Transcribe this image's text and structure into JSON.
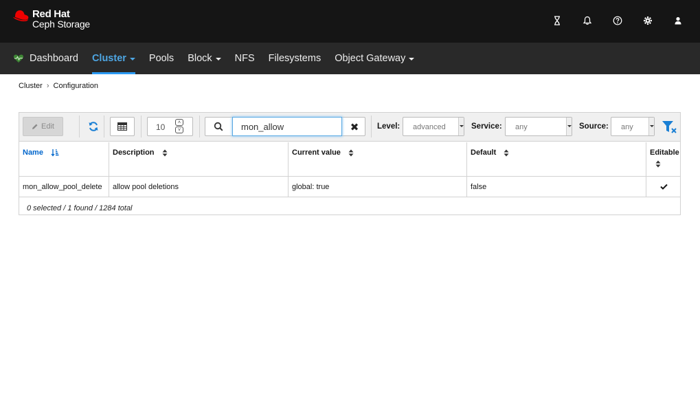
{
  "brand": {
    "line1": "Red Hat",
    "line2": "Ceph Storage",
    "accent": "#ee0000"
  },
  "header_icons": [
    "hourglass-icon",
    "bell-icon",
    "help-icon",
    "gear-icon",
    "user-icon"
  ],
  "nav": {
    "items": [
      {
        "label": "Dashboard",
        "active": false,
        "dropdown": false
      },
      {
        "label": "Cluster",
        "active": true,
        "dropdown": true
      },
      {
        "label": "Pools",
        "active": false,
        "dropdown": false
      },
      {
        "label": "Block",
        "active": false,
        "dropdown": true
      },
      {
        "label": "NFS",
        "active": false,
        "dropdown": false
      },
      {
        "label": "Filesystems",
        "active": false,
        "dropdown": false
      },
      {
        "label": "Object Gateway",
        "active": false,
        "dropdown": true
      }
    ],
    "active_color": "#2b9af3"
  },
  "breadcrumb": {
    "parent": "Cluster",
    "current": "Configuration"
  },
  "toolbar": {
    "edit_label": "Edit",
    "page_size": "10",
    "search_value": "mon_allow",
    "level_label": "Level:",
    "level_value": "advanced",
    "service_label": "Service:",
    "service_value": "any",
    "source_label": "Source:",
    "source_value": "any"
  },
  "table": {
    "columns": [
      "Name",
      "Description",
      "Current value",
      "Default",
      "Editable"
    ],
    "rows": [
      {
        "name": "mon_allow_pool_delete",
        "description": "allow pool deletions",
        "current": "global: true",
        "default": "false",
        "editable": true
      }
    ],
    "footer": "0 selected / 1 found / 1284 total"
  }
}
